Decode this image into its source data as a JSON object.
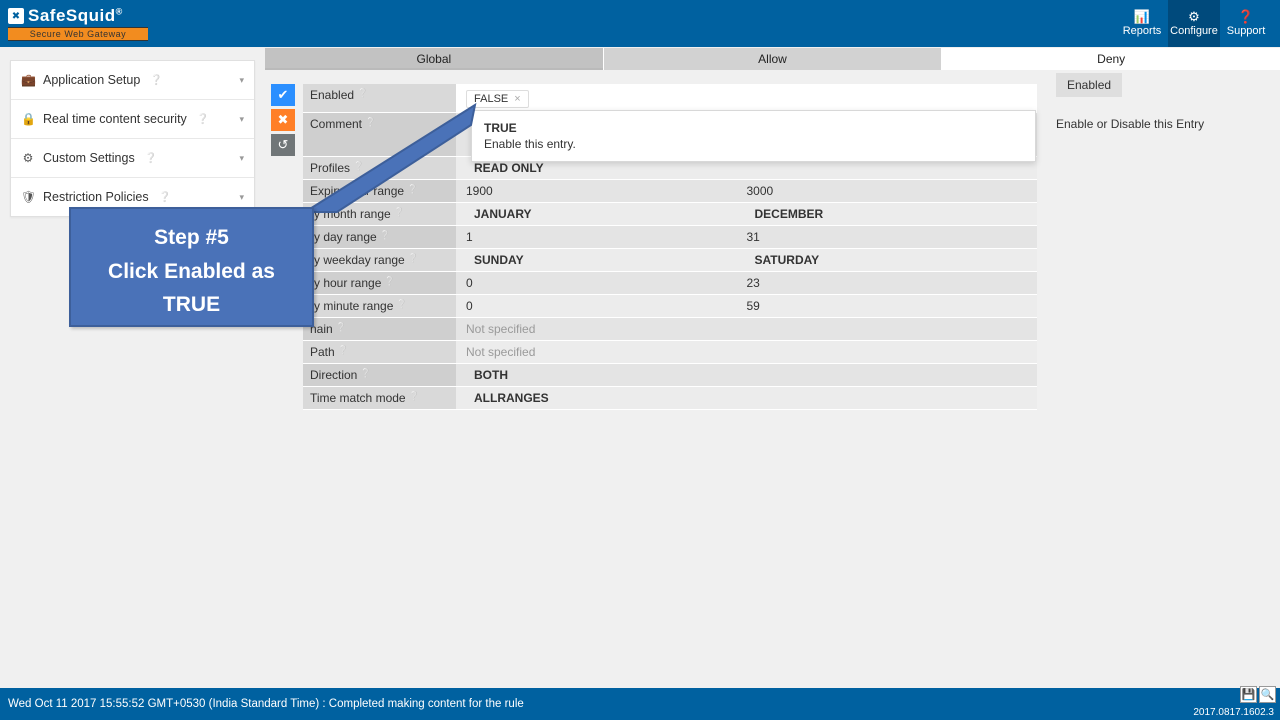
{
  "header": {
    "logo_text": "SafeSquid",
    "tagline": "Secure Web Gateway",
    "nav": [
      {
        "icon": "📊",
        "label": "Reports"
      },
      {
        "icon": "⚙",
        "label": "Configure"
      },
      {
        "icon": "❓",
        "label": "Support"
      }
    ]
  },
  "sidebar": {
    "items": [
      {
        "icon": "💼",
        "label": "Application Setup"
      },
      {
        "icon": "🔒",
        "label": "Real time content security"
      },
      {
        "icon": "⚙",
        "label": "Custom Settings"
      },
      {
        "icon": "🛡",
        "label": "Restriction Policies"
      }
    ]
  },
  "tabs": {
    "global": "Global",
    "allow": "Allow",
    "deny": "Deny"
  },
  "actions": {
    "ok": "✔",
    "cancel": "✖",
    "reset": "↺"
  },
  "form": {
    "enabled_label": "Enabled",
    "enabled_chip": "FALSE",
    "comment_label": "Comment",
    "profiles_label": "Profiles",
    "profiles_value": "READ ONLY",
    "expiry_year_label": "Expiry year range",
    "expiry_year_from": "1900",
    "expiry_year_to": "3000",
    "expiry_month_label": "ry month range",
    "expiry_month_from": "JANUARY",
    "expiry_month_to": "DECEMBER",
    "expiry_day_label": "ry day range",
    "expiry_day_from": "1",
    "expiry_day_to": "31",
    "expiry_weekday_label": "ry weekday range",
    "expiry_weekday_from": "SUNDAY",
    "expiry_weekday_to": "SATURDAY",
    "expiry_hour_label": "ry hour range",
    "expiry_hour_from": "0",
    "expiry_hour_to": "23",
    "expiry_minute_label": "ry minute range",
    "expiry_minute_from": "0",
    "expiry_minute_to": "59",
    "domain_label": "nain",
    "domain_value": "Not specified",
    "path_label": "Path",
    "path_value": "Not specified",
    "direction_label": "Direction",
    "direction_value": "BOTH",
    "timematch_label": "Time match mode",
    "timematch_value": "ALLRANGES"
  },
  "right": {
    "badge": "Enabled",
    "desc": "Enable or Disable this Entry"
  },
  "dropdown": {
    "title": "TRUE",
    "sub": "Enable this entry."
  },
  "callout": {
    "line1": "Step #5",
    "line2": "Click Enabled as",
    "line3": "TRUE"
  },
  "footer": {
    "status": "Wed Oct 11 2017 15:55:52 GMT+0530 (India Standard Time) : Completed making content for the rule",
    "version": "2017.0817.1602.3"
  }
}
